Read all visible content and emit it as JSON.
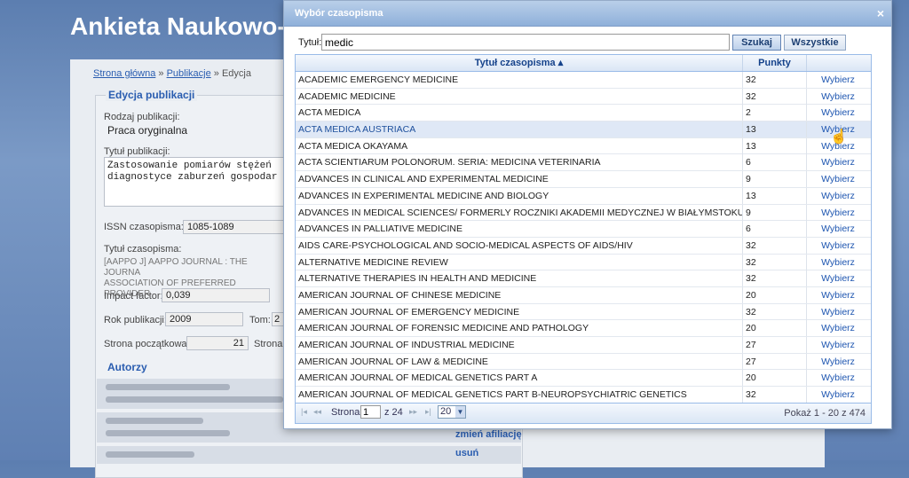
{
  "background": {
    "app_title": "Ankieta Naukowo-",
    "breadcrumb": {
      "home": "Strona główna",
      "sep1": "»",
      "publications": "Publikacje",
      "sep2": "»",
      "current": "Edycja"
    },
    "section_title": "Edycja publikacji",
    "pub_type_label": "Rodzaj publikacji:",
    "pub_type_value": "Praca oryginalna",
    "pub_title_label": "Tytuł publikacji:",
    "pub_title_line1": "Zastosowanie pomiarów stężeń",
    "pub_title_line2": "diagnostyce zaburzeń gospodar",
    "issn_label": "ISSN czasopisma:",
    "issn_value": "1085-1089",
    "journal_label": "Tytuł czasopisma:",
    "journal_text_line1": "[AAPPO J] AAPPO JOURNAL : THE JOURNA",
    "journal_text_line2": "ASSOCIATION OF PREFERRED PROVIDER",
    "impact_label": "Impact factor:",
    "impact_value": "0,039",
    "year_label": "Rok publikacji:",
    "year_value": "2009",
    "volume_label": "Tom:",
    "volume_value": "2",
    "start_page_label": "Strona początkowa:",
    "start_page_value": "21",
    "end_page_label": "Strona",
    "authors_title": "Autorzy",
    "change_affiliation": "zmień afiliację",
    "remove": "usuń"
  },
  "modal": {
    "title": "Wybór czasopisma",
    "close": "×",
    "search_label": "Tytuł:",
    "search_value": "medic",
    "search_button": "Szukaj",
    "all_button": "Wszystkie",
    "col_title": "Tytuł czasopisma ▴",
    "col_points": "Punkty",
    "select_label": "Wybierz",
    "rows": [
      {
        "title": "ACADEMIC EMERGENCY MEDICINE",
        "points": "32",
        "action": "Wybierz"
      },
      {
        "title": "ACADEMIC MEDICINE",
        "points": "32",
        "action": "Wybierz"
      },
      {
        "title": "ACTA MEDICA",
        "points": "2",
        "action": "Wybierz"
      },
      {
        "title": "ACTA MEDICA AUSTRIACA",
        "points": "13",
        "action": "Wybierz"
      },
      {
        "title": "ACTA MEDICA OKAYAMA",
        "points": "13",
        "action": "Wybierz"
      },
      {
        "title": "ACTA SCIENTIARUM POLONORUM. SERIA: MEDICINA VETERINARIA",
        "points": "6",
        "action": "Wybierz"
      },
      {
        "title": "ADVANCES IN CLINICAL AND EXPERIMENTAL  MEDICINE",
        "points": "9",
        "action": "Wybierz"
      },
      {
        "title": "ADVANCES IN EXPERIMENTAL MEDICINE AND BIOLOGY",
        "points": "13",
        "action": "Wybierz"
      },
      {
        "title": "ADVANCES IN MEDICAL SCIENCES/ FORMERLY ROCZNIKI AKADEMII MEDYCZNEJ W BIAŁYMSTOKU",
        "points": "9",
        "action": "Wybierz"
      },
      {
        "title": "ADVANCES IN PALLIATIVE MEDICINE",
        "points": "6",
        "action": "Wybierz"
      },
      {
        "title": "AIDS CARE-PSYCHOLOGICAL AND SOCIO-MEDICAL ASPECTS OF AIDS/HIV",
        "points": "32",
        "action": "Wybierz"
      },
      {
        "title": "ALTERNATIVE MEDICINE REVIEW",
        "points": "32",
        "action": "Wybierz"
      },
      {
        "title": "ALTERNATIVE THERAPIES IN HEALTH AND MEDICINE",
        "points": "32",
        "action": "Wybierz"
      },
      {
        "title": "AMERICAN JOURNAL OF CHINESE MEDICINE",
        "points": "20",
        "action": "Wybierz"
      },
      {
        "title": "AMERICAN JOURNAL OF EMERGENCY MEDICINE",
        "points": "32",
        "action": "Wybierz"
      },
      {
        "title": "AMERICAN JOURNAL OF FORENSIC MEDICINE AND PATHOLOGY",
        "points": "20",
        "action": "Wybierz"
      },
      {
        "title": "AMERICAN JOURNAL OF INDUSTRIAL MEDICINE",
        "points": "27",
        "action": "Wybierz"
      },
      {
        "title": "AMERICAN JOURNAL OF LAW & MEDICINE",
        "points": "27",
        "action": "Wybierz"
      },
      {
        "title": "AMERICAN JOURNAL OF MEDICAL GENETICS PART A",
        "points": "20",
        "action": "Wybierz"
      },
      {
        "title": "AMERICAN JOURNAL OF MEDICAL GENETICS PART B-NEUROPSYCHIATRIC GENETICS",
        "points": "32",
        "action": "Wybierz"
      }
    ],
    "selected_row": 3,
    "pager": {
      "first": "|◂",
      "prev": "◂◂",
      "page_label": "Strona",
      "page_value": "1",
      "of_text": "z 24",
      "next": "▸▸",
      "last": "▸|",
      "page_size": "20",
      "status": "Pokaż 1 - 20 z 474"
    }
  },
  "colors": {
    "accent": "#2a5db0",
    "header": "#15428b",
    "selected_row": "#dfe8f6"
  }
}
